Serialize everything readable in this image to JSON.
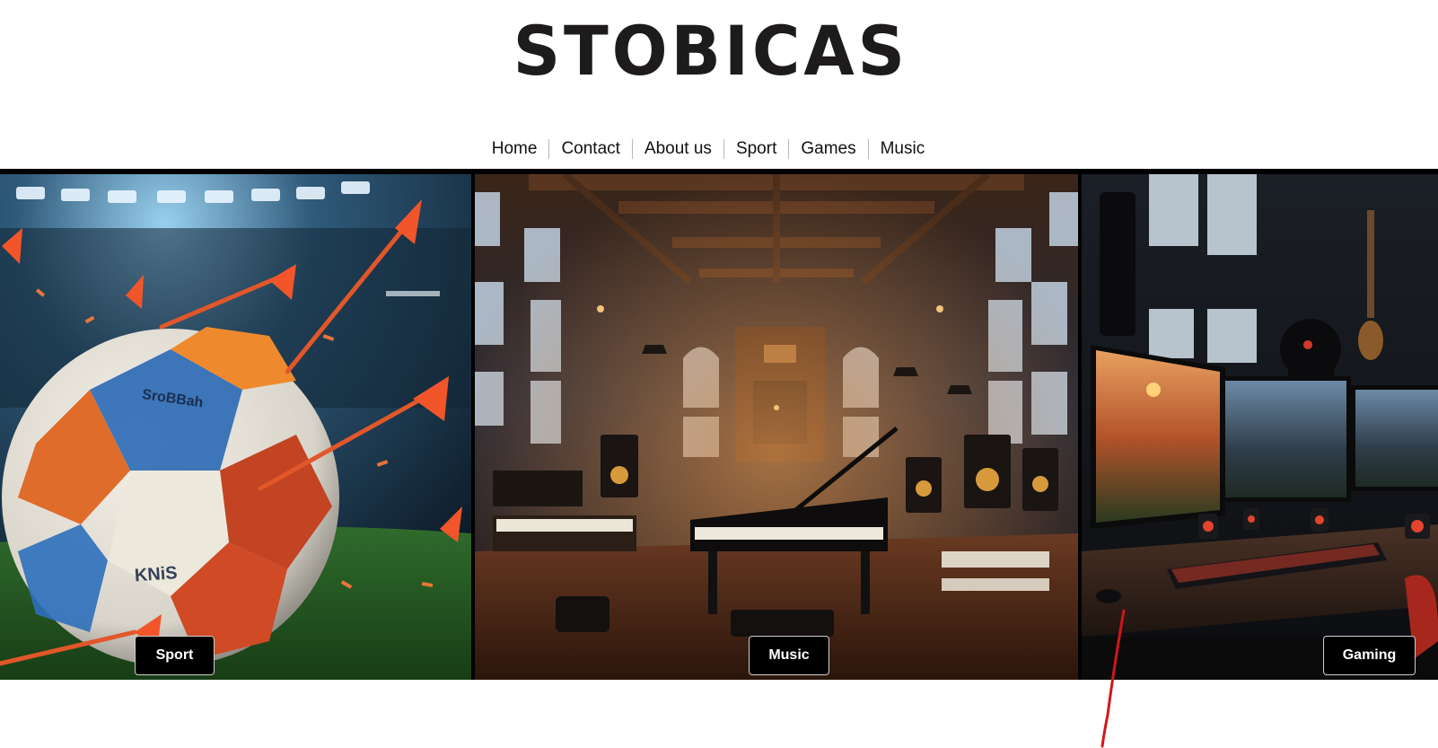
{
  "brand": {
    "logo_text": "STOBICAS"
  },
  "nav": {
    "items": [
      {
        "label": "Home"
      },
      {
        "label": "Contact"
      },
      {
        "label": "About us"
      },
      {
        "label": "Sport"
      },
      {
        "label": "Games"
      },
      {
        "label": "Music"
      }
    ]
  },
  "gallery": {
    "panels": [
      {
        "image": "soccer-ball-with-darts-in-stadium",
        "button_label": "Sport"
      },
      {
        "image": "grand-hall-music-studio-with-piano",
        "button_label": "Music"
      },
      {
        "image": "gaming-setup-with-monitors",
        "button_label": "Gaming"
      }
    ],
    "ball_print": "SroBBah",
    "ball_print_2": "KNiS"
  },
  "colors": {
    "annotation": "#d0161b",
    "dart_orange": "#e2572a",
    "button_bg": "#000000"
  }
}
